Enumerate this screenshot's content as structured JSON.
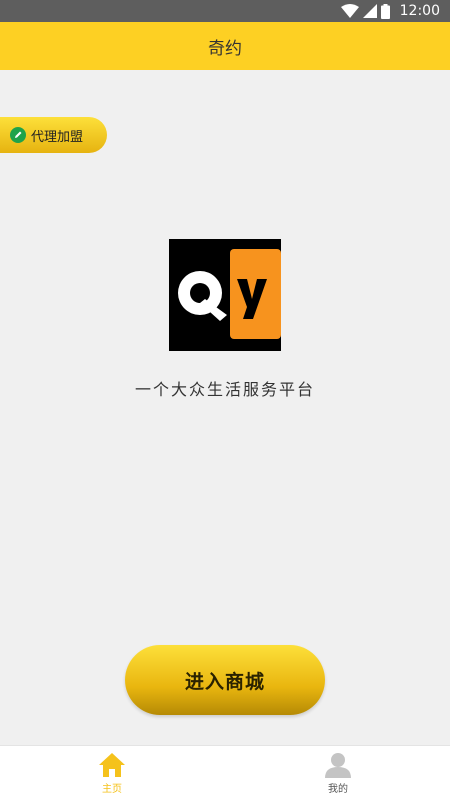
{
  "status_bar": {
    "time": "12:00"
  },
  "header": {
    "title": "奇约"
  },
  "agent_pill": {
    "label": "代理加盟",
    "icon": "pencil-icon"
  },
  "logo": {
    "letters": "Qy",
    "accent": "#f7931e"
  },
  "slogan": "一个大众生活服务平台",
  "enter_button": {
    "label": "进入商城"
  },
  "tabs": [
    {
      "label": "主页",
      "icon": "home-icon",
      "active": true
    },
    {
      "label": "我的",
      "icon": "user-icon",
      "active": false
    }
  ],
  "colors": {
    "brand": "#fdd023",
    "accent": "#f5c21b"
  }
}
